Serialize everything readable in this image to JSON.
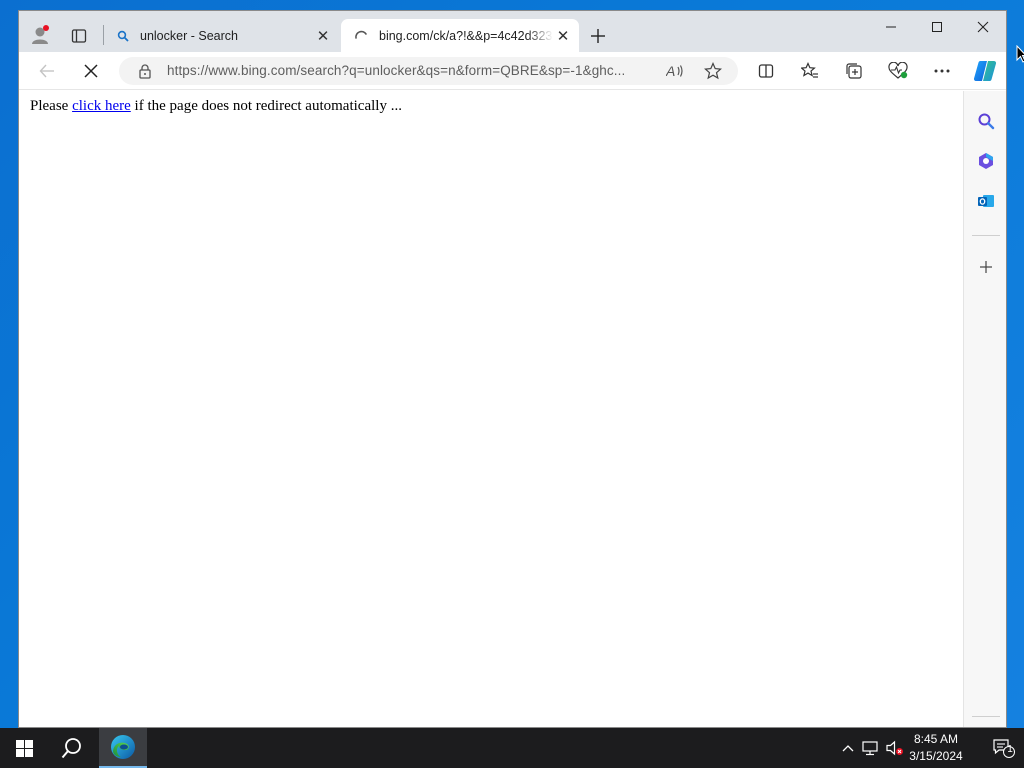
{
  "browser": {
    "tabs": [
      {
        "title": "unlocker - Search",
        "favicon": "search-icon",
        "active": false
      },
      {
        "title": "bing.com/ck/a?!&&p=4c42d323",
        "favicon": "loading-spinner-icon",
        "active": true
      }
    ],
    "address": {
      "url": "https://www.bing.com/search?q=unlocker&qs=n&form=QBRE&sp=-1&ghc..."
    },
    "accent_color": "#0a78d7"
  },
  "page": {
    "redirect_prefix": "Please ",
    "redirect_link": "click here",
    "redirect_suffix": " if the page does not redirect automatically ..."
  },
  "taskbar": {
    "time": "8:45 AM",
    "date": "3/15/2024",
    "notification_count": "1"
  }
}
